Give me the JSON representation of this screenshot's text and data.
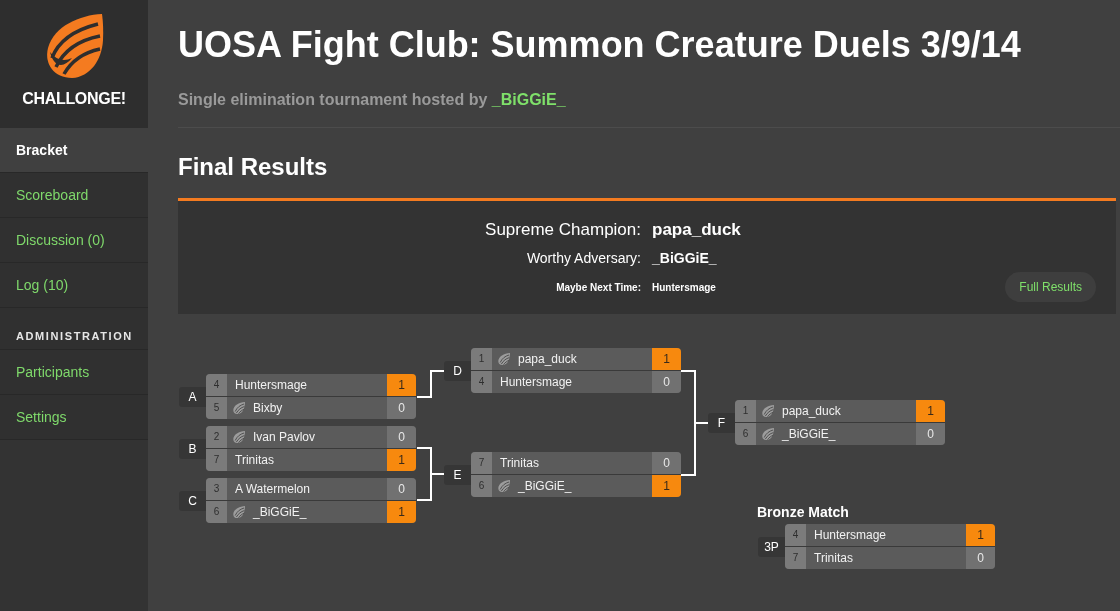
{
  "sidebar": {
    "logo_text": "CHALLONGE!",
    "items": [
      {
        "label": "Bracket",
        "selected": true
      },
      {
        "label": "Scoreboard",
        "selected": false
      },
      {
        "label": "Discussion (0)",
        "selected": false
      },
      {
        "label": "Log (10)",
        "selected": false
      }
    ],
    "admin_heading": "ADMINISTRATION",
    "admin_items": [
      {
        "label": "Participants",
        "selected": false
      },
      {
        "label": "Settings",
        "selected": false
      }
    ]
  },
  "header": {
    "title": "UOSA Fight Club: Summon Creature Duels 3/9/14",
    "subtitle": "Single elimination tournament hosted by",
    "host": "_BiGGiE_"
  },
  "final_results": {
    "heading": "Final Results",
    "placings": [
      {
        "kind": "first",
        "label": "Supreme Champion:",
        "name": "papa_duck"
      },
      {
        "kind": "second",
        "label": "Worthy Adversary:",
        "name": "_BiGGiE_"
      },
      {
        "kind": "third",
        "label": "Maybe Next Time:",
        "name": "Huntersmage"
      }
    ],
    "button": "Full Results"
  },
  "bracket": {
    "rounds": [
      {
        "matches": [
          {
            "label": "A",
            "players": [
              {
                "seed": "4",
                "name": "Huntersmage",
                "avatar": false,
                "score": "1",
                "winner": true
              },
              {
                "seed": "5",
                "name": "Bixby",
                "avatar": true,
                "score": "0",
                "winner": false
              }
            ]
          },
          {
            "label": "B",
            "players": [
              {
                "seed": "2",
                "name": "Ivan Pavlov",
                "avatar": true,
                "score": "0",
                "winner": false
              },
              {
                "seed": "7",
                "name": "Trinitas",
                "avatar": false,
                "score": "1",
                "winner": true
              }
            ]
          },
          {
            "label": "C",
            "players": [
              {
                "seed": "3",
                "name": "A Watermelon",
                "avatar": false,
                "score": "0",
                "winner": false
              },
              {
                "seed": "6",
                "name": "_BiGGiE_",
                "avatar": true,
                "score": "1",
                "winner": true
              }
            ]
          }
        ]
      },
      {
        "matches": [
          {
            "label": "D",
            "players": [
              {
                "seed": "1",
                "name": "papa_duck",
                "avatar": true,
                "score": "1",
                "winner": true
              },
              {
                "seed": "4",
                "name": "Huntersmage",
                "avatar": false,
                "score": "0",
                "winner": false
              }
            ]
          },
          {
            "label": "E",
            "players": [
              {
                "seed": "7",
                "name": "Trinitas",
                "avatar": false,
                "score": "0",
                "winner": false
              },
              {
                "seed": "6",
                "name": "_BiGGiE_",
                "avatar": true,
                "score": "1",
                "winner": true
              }
            ]
          }
        ]
      },
      {
        "matches": [
          {
            "label": "F",
            "players": [
              {
                "seed": "1",
                "name": "papa_duck",
                "avatar": true,
                "score": "1",
                "winner": true
              },
              {
                "seed": "6",
                "name": "_BiGGiE_",
                "avatar": true,
                "score": "0",
                "winner": false
              }
            ]
          }
        ]
      }
    ],
    "bronze": {
      "title": "Bronze Match",
      "match": {
        "label": "3P",
        "players": [
          {
            "seed": "4",
            "name": "Huntersmage",
            "avatar": false,
            "score": "1",
            "winner": true
          },
          {
            "seed": "7",
            "name": "Trinitas",
            "avatar": false,
            "score": "0",
            "winner": false
          }
        ]
      }
    }
  }
}
